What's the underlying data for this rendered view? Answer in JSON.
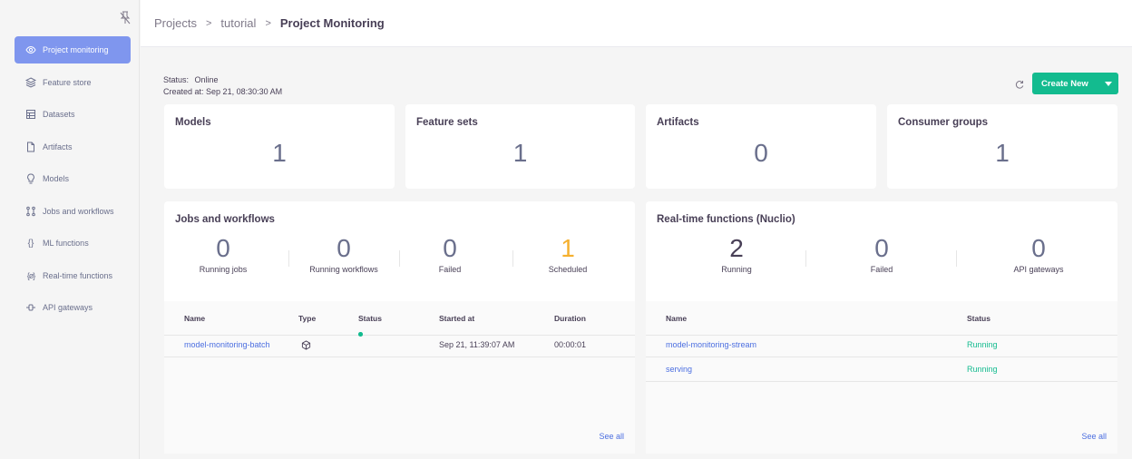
{
  "breadcrumb": {
    "items": [
      "Projects",
      "tutorial"
    ],
    "separator": ">",
    "current": "Project Monitoring"
  },
  "sidebar": {
    "items": [
      {
        "label": "Project monitoring",
        "icon": "eye-icon",
        "active": true
      },
      {
        "label": "Feature store",
        "icon": "cube-stack-icon"
      },
      {
        "label": "Datasets",
        "icon": "table-icon"
      },
      {
        "label": "Artifacts",
        "icon": "file-icon"
      },
      {
        "label": "Models",
        "icon": "lightbulb-icon"
      },
      {
        "label": "Jobs and workflows",
        "icon": "workflow-icon"
      },
      {
        "label": "ML functions",
        "icon": "curly-braces-icon"
      },
      {
        "label": "Real-time functions",
        "icon": "realtime-braces-icon"
      },
      {
        "label": "API gateways",
        "icon": "api-gateway-icon"
      }
    ]
  },
  "status": {
    "status_label": "Status:",
    "status_value": "Online",
    "created_label": "Created at:",
    "created_value": "Sep 21, 08:30:30 AM"
  },
  "actions": {
    "create_label": "Create New"
  },
  "summary_cards": [
    {
      "title": "Models",
      "value": "1"
    },
    {
      "title": "Feature sets",
      "value": "1"
    },
    {
      "title": "Artifacts",
      "value": "0"
    },
    {
      "title": "Consumer groups",
      "value": "1"
    }
  ],
  "jobs": {
    "title": "Jobs and workflows",
    "stats": [
      {
        "value": "0",
        "label": "Running jobs"
      },
      {
        "value": "0",
        "label": "Running workflows"
      },
      {
        "value": "0",
        "label": "Failed"
      },
      {
        "value": "1",
        "label": "Scheduled"
      }
    ],
    "columns": [
      "Name",
      "Type",
      "Status",
      "Started at",
      "Duration"
    ],
    "rows": [
      {
        "name": "model-monitoring-batch",
        "type_icon": "job-cube-icon",
        "status": "running-dots",
        "started": "Sep 21, 11:39:07 AM",
        "duration": "00:00:01"
      }
    ],
    "see_all": "See all"
  },
  "realtime": {
    "title": "Real-time functions (Nuclio)",
    "stats": [
      {
        "value": "2",
        "label": "Running"
      },
      {
        "value": "0",
        "label": "Failed"
      },
      {
        "value": "0",
        "label": "API gateways"
      }
    ],
    "columns": [
      "Name",
      "Status"
    ],
    "rows": [
      {
        "name": "model-monitoring-stream",
        "status": "Running"
      },
      {
        "name": "serving",
        "status": "Running"
      }
    ],
    "see_all": "See all"
  },
  "colors": {
    "accent": "#7f96ee",
    "primary_button": "#13bb8f",
    "link": "#4b6ee0",
    "scheduled": "#f5b02e",
    "running": "#13bb8f"
  }
}
